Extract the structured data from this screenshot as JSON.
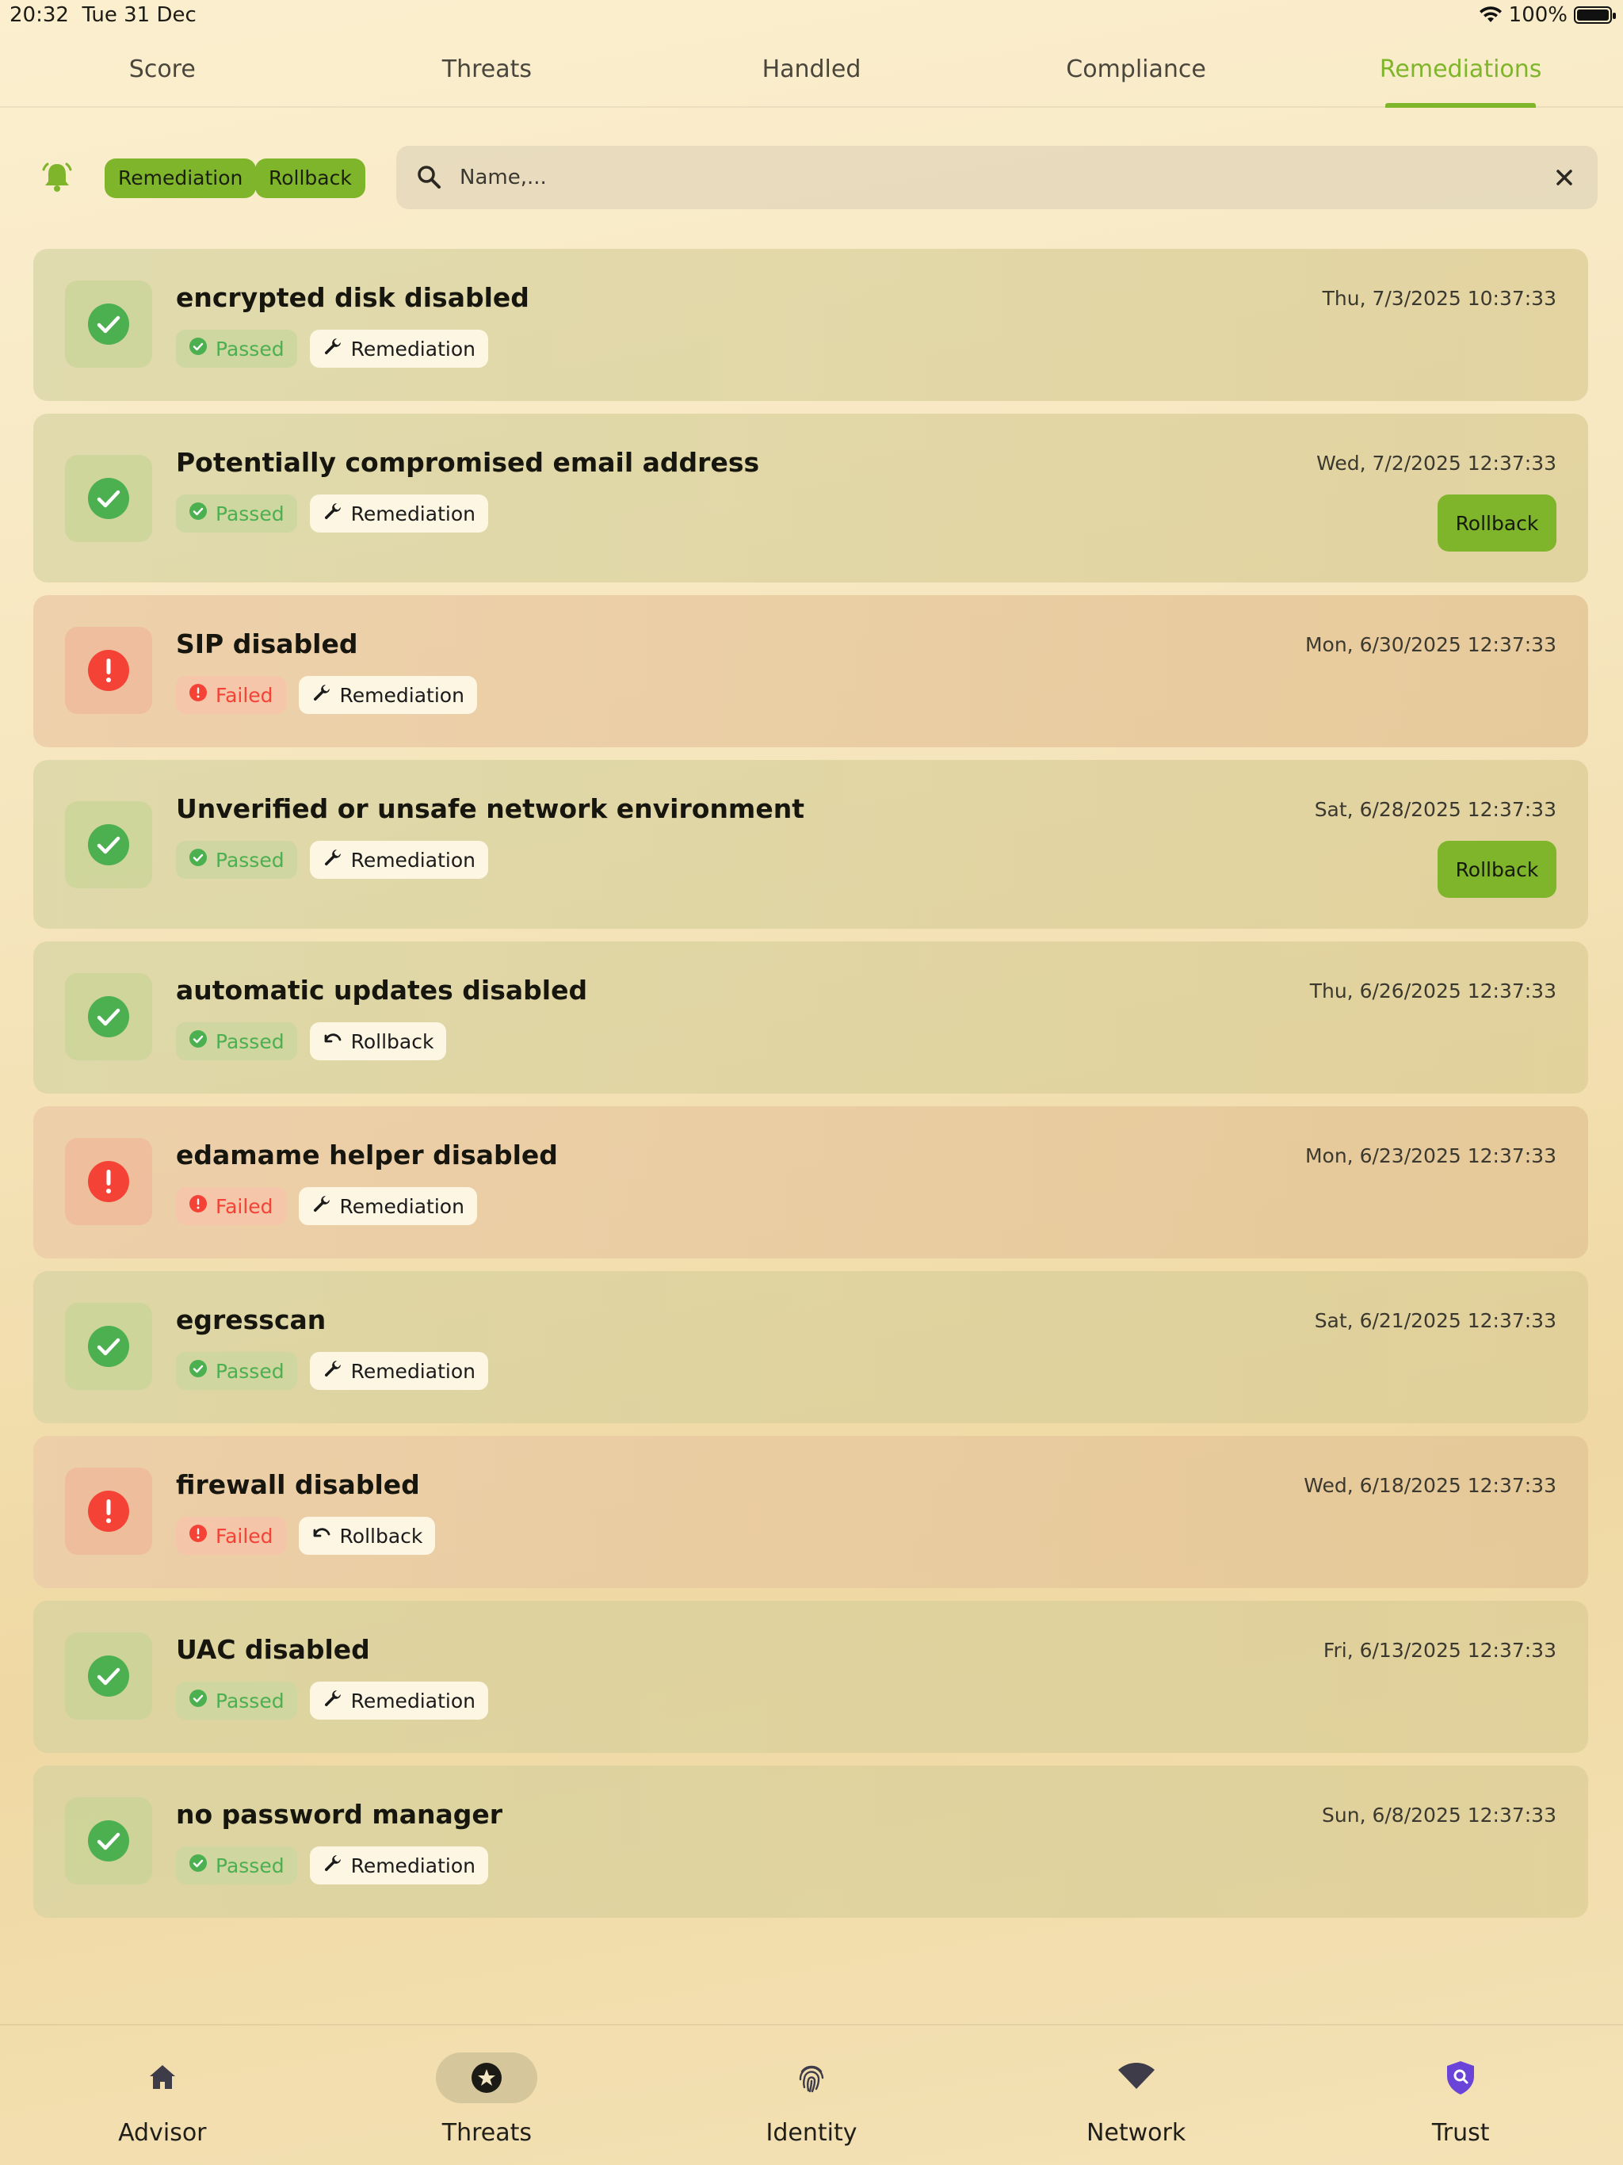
{
  "status_bar": {
    "time": "20:32",
    "date": "Tue 31 Dec",
    "battery": "100%",
    "battery_level": 1.0
  },
  "top_tabs": [
    {
      "label": "Score",
      "active": false
    },
    {
      "label": "Threats",
      "active": false
    },
    {
      "label": "Handled",
      "active": false
    },
    {
      "label": "Compliance",
      "active": false
    },
    {
      "label": "Remediations",
      "active": true
    }
  ],
  "filters": {
    "chips": [
      "Remediation",
      "Rollback"
    ],
    "search": {
      "placeholder": "Name,...",
      "value": ""
    }
  },
  "colors": {
    "accent": "#7fb52b",
    "passed": "#4caf50",
    "failed": "#f44336"
  },
  "items": [
    {
      "title": "encrypted disk disabled",
      "time": "Thu, 7/3/2025 10:37:33",
      "status": "Passed",
      "type": "Remediation",
      "action": null
    },
    {
      "title": "Potentially compromised email address",
      "time": "Wed, 7/2/2025 12:37:33",
      "status": "Passed",
      "type": "Remediation",
      "action": "Rollback"
    },
    {
      "title": "SIP disabled",
      "time": "Mon, 6/30/2025 12:37:33",
      "status": "Failed",
      "type": "Remediation",
      "action": null
    },
    {
      "title": "Unverified or unsafe network environment",
      "time": "Sat, 6/28/2025 12:37:33",
      "status": "Passed",
      "type": "Remediation",
      "action": "Rollback"
    },
    {
      "title": "automatic updates disabled",
      "time": "Thu, 6/26/2025 12:37:33",
      "status": "Passed",
      "type": "Rollback",
      "action": null
    },
    {
      "title": "edamame helper disabled",
      "time": "Mon, 6/23/2025 12:37:33",
      "status": "Failed",
      "type": "Remediation",
      "action": null
    },
    {
      "title": "egresscan",
      "time": "Sat, 6/21/2025 12:37:33",
      "status": "Passed",
      "type": "Remediation",
      "action": null
    },
    {
      "title": "firewall disabled",
      "time": "Wed, 6/18/2025 12:37:33",
      "status": "Failed",
      "type": "Rollback",
      "action": null
    },
    {
      "title": "UAC disabled",
      "time": "Fri, 6/13/2025 12:37:33",
      "status": "Passed",
      "type": "Remediation",
      "action": null
    },
    {
      "title": "no password manager",
      "time": "Sun, 6/8/2025 12:37:33",
      "status": "Passed",
      "type": "Remediation",
      "action": null
    }
  ],
  "bottom_nav": [
    {
      "label": "Advisor",
      "icon": "home-icon",
      "active": false
    },
    {
      "label": "Threats",
      "icon": "star-badge-icon",
      "active": true
    },
    {
      "label": "Identity",
      "icon": "fingerprint-icon",
      "active": false
    },
    {
      "label": "Network",
      "icon": "wifi-icon",
      "active": false
    },
    {
      "label": "Trust",
      "icon": "shield-search-icon",
      "active": false
    }
  ]
}
